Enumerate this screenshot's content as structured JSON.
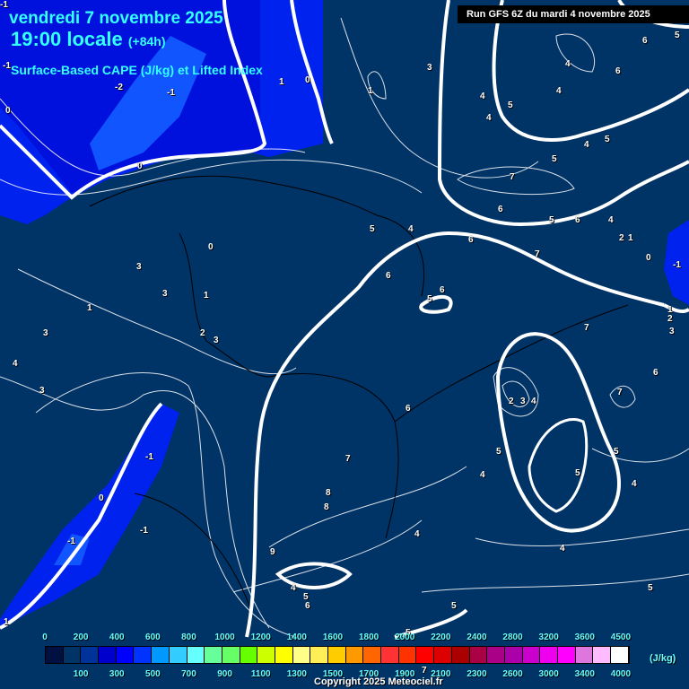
{
  "header": {
    "date": "vendredi 7 novembre 2025",
    "time": "19:00 locale",
    "lead": "(+84h)",
    "parameter": "Surface-Based CAPE (J/kg) et Lifted Index",
    "run": "Run GFS 6Z du mardi 4 novembre 2025"
  },
  "map": {
    "background_color": "#003366",
    "contour_labels": [
      "-1",
      "-2",
      "-1",
      "0",
      "1",
      "0",
      "3",
      "1",
      "4",
      "5",
      "4",
      "4",
      "6",
      "5",
      "6",
      "5",
      "4",
      "4",
      "0",
      "-1",
      "3",
      "0",
      "3",
      "1",
      "2",
      "3",
      "1",
      "3",
      "4",
      "3",
      "5",
      "4",
      "5",
      "6",
      "6",
      "7",
      "6",
      "5",
      "4",
      "6",
      "7",
      "5",
      "6",
      "2",
      "1",
      "0",
      "-1",
      "1",
      "2",
      "3",
      "7",
      "6",
      "7",
      "2",
      "3",
      "4",
      "5",
      "5",
      "4",
      "4",
      "5",
      "6",
      "7",
      "8",
      "8",
      "9",
      "4",
      "5",
      "6",
      "5",
      "4",
      "4",
      "5",
      "-1",
      "-1",
      "0",
      "-1",
      "1",
      "5",
      "7"
    ]
  },
  "legend": {
    "unit": "(J/kg)",
    "top_labels": [
      "0",
      "200",
      "400",
      "600",
      "800",
      "1000",
      "1200",
      "1400",
      "1600",
      "1800",
      "2000",
      "2200",
      "2400",
      "2800",
      "3200",
      "3600",
      "4500"
    ],
    "bottom_labels": [
      "100",
      "300",
      "500",
      "700",
      "900",
      "1100",
      "1300",
      "1500",
      "1700",
      "1900",
      "2100",
      "2300",
      "2600",
      "3000",
      "3400",
      "4000"
    ],
    "colors": [
      "#001040",
      "#003366",
      "#003399",
      "#0000cc",
      "#0000ff",
      "#0033ff",
      "#0099ff",
      "#33ccff",
      "#66ffff",
      "#66ff99",
      "#66ff66",
      "#66ff00",
      "#ccff00",
      "#ffff00",
      "#ffff88",
      "#ffee55",
      "#ffcc00",
      "#ff9900",
      "#ff6600",
      "#ff3333",
      "#ff3300",
      "#ff0000",
      "#dd0000",
      "#aa0000",
      "#aa0044",
      "#aa0088",
      "#aa00aa",
      "#cc00cc",
      "#ee00ee",
      "#ff00ff",
      "#dd77dd",
      "#ffbbff",
      "#ffffff"
    ]
  },
  "footer": {
    "copyright": "Copyright 2025 Meteociel.fr"
  }
}
